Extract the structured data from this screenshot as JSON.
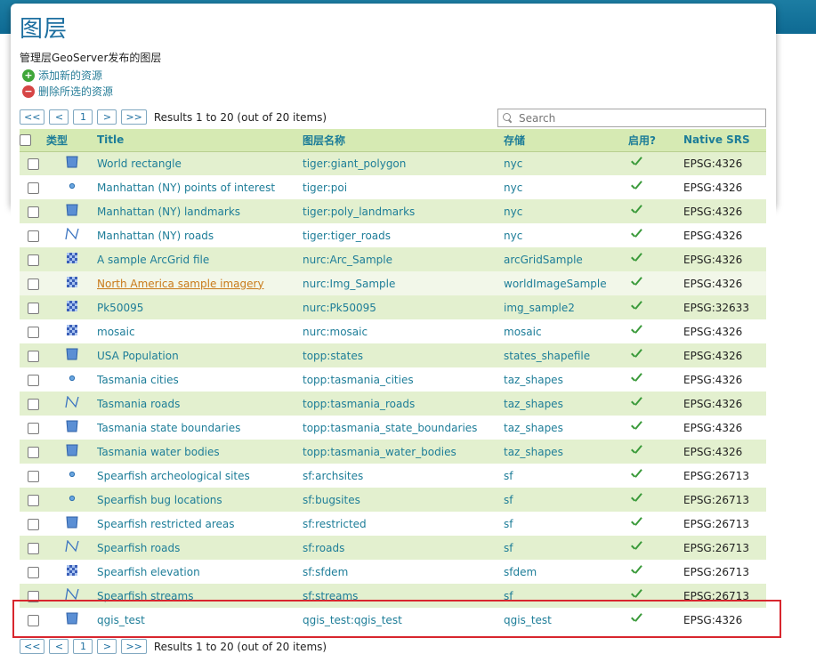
{
  "page": {
    "title": "图层",
    "description": "管理层GeoServer发布的图层",
    "add_label": "添加新的资源",
    "remove_label": "删除所选的资源"
  },
  "pager": {
    "first": "<<",
    "prev": "<",
    "page": "1",
    "next": ">",
    "last": ">>",
    "status": "Results 1 to 20 (out of 20 items)"
  },
  "search": {
    "placeholder": "Search"
  },
  "columns": {
    "type": "类型",
    "title": "Title",
    "name": "图层名称",
    "store": "存储",
    "enabled": "启用?",
    "srs": "Native SRS"
  },
  "rows": [
    {
      "type": "polygon-icon",
      "title": "World rectangle",
      "name": "tiger:giant_polygon",
      "store": "nyc",
      "srs": "EPSG:4326"
    },
    {
      "type": "point-icon",
      "title": "Manhattan (NY) points of interest",
      "name": "tiger:poi",
      "store": "nyc",
      "srs": "EPSG:4326"
    },
    {
      "type": "polygon-icon",
      "title": "Manhattan (NY) landmarks",
      "name": "tiger:poly_landmarks",
      "store": "nyc",
      "srs": "EPSG:4326"
    },
    {
      "type": "line-icon",
      "title": "Manhattan (NY) roads",
      "name": "tiger:tiger_roads",
      "store": "nyc",
      "srs": "EPSG:4326"
    },
    {
      "type": "raster-icon",
      "title": "A sample ArcGrid file",
      "name": "nurc:Arc_Sample",
      "store": "arcGridSample",
      "srs": "EPSG:4326"
    },
    {
      "type": "raster-icon",
      "title": "North America sample imagery",
      "name": "nurc:Img_Sample",
      "store": "worldImageSample",
      "srs": "EPSG:4326"
    },
    {
      "type": "raster-icon",
      "title": "Pk50095",
      "name": "nurc:Pk50095",
      "store": "img_sample2",
      "srs": "EPSG:32633"
    },
    {
      "type": "raster-icon",
      "title": "mosaic",
      "name": "nurc:mosaic",
      "store": "mosaic",
      "srs": "EPSG:4326"
    },
    {
      "type": "polygon-icon",
      "title": "USA Population",
      "name": "topp:states",
      "store": "states_shapefile",
      "srs": "EPSG:4326"
    },
    {
      "type": "point-icon",
      "title": "Tasmania cities",
      "name": "topp:tasmania_cities",
      "store": "taz_shapes",
      "srs": "EPSG:4326"
    },
    {
      "type": "line-icon",
      "title": "Tasmania roads",
      "name": "topp:tasmania_roads",
      "store": "taz_shapes",
      "srs": "EPSG:4326"
    },
    {
      "type": "polygon-icon",
      "title": "Tasmania state boundaries",
      "name": "topp:tasmania_state_boundaries",
      "store": "taz_shapes",
      "srs": "EPSG:4326"
    },
    {
      "type": "polygon-icon",
      "title": "Tasmania water bodies",
      "name": "topp:tasmania_water_bodies",
      "store": "taz_shapes",
      "srs": "EPSG:4326"
    },
    {
      "type": "point-icon",
      "title": "Spearfish archeological sites",
      "name": "sf:archsites",
      "store": "sf",
      "srs": "EPSG:26713"
    },
    {
      "type": "point-icon",
      "title": "Spearfish bug locations",
      "name": "sf:bugsites",
      "store": "sf",
      "srs": "EPSG:26713"
    },
    {
      "type": "polygon-icon",
      "title": "Spearfish restricted areas",
      "name": "sf:restricted",
      "store": "sf",
      "srs": "EPSG:26713"
    },
    {
      "type": "line-icon",
      "title": "Spearfish roads",
      "name": "sf:roads",
      "store": "sf",
      "srs": "EPSG:26713"
    },
    {
      "type": "raster-icon",
      "title": "Spearfish elevation",
      "name": "sf:sfdem",
      "store": "sfdem",
      "srs": "EPSG:26713"
    },
    {
      "type": "line-icon",
      "title": "Spearfish streams",
      "name": "sf:streams",
      "store": "sf",
      "srs": "EPSG:26713"
    },
    {
      "type": "polygon-icon",
      "title": "qgis_test",
      "name": "qgis_test:qgis_test",
      "store": "qgis_test",
      "srs": "EPSG:4326"
    }
  ]
}
